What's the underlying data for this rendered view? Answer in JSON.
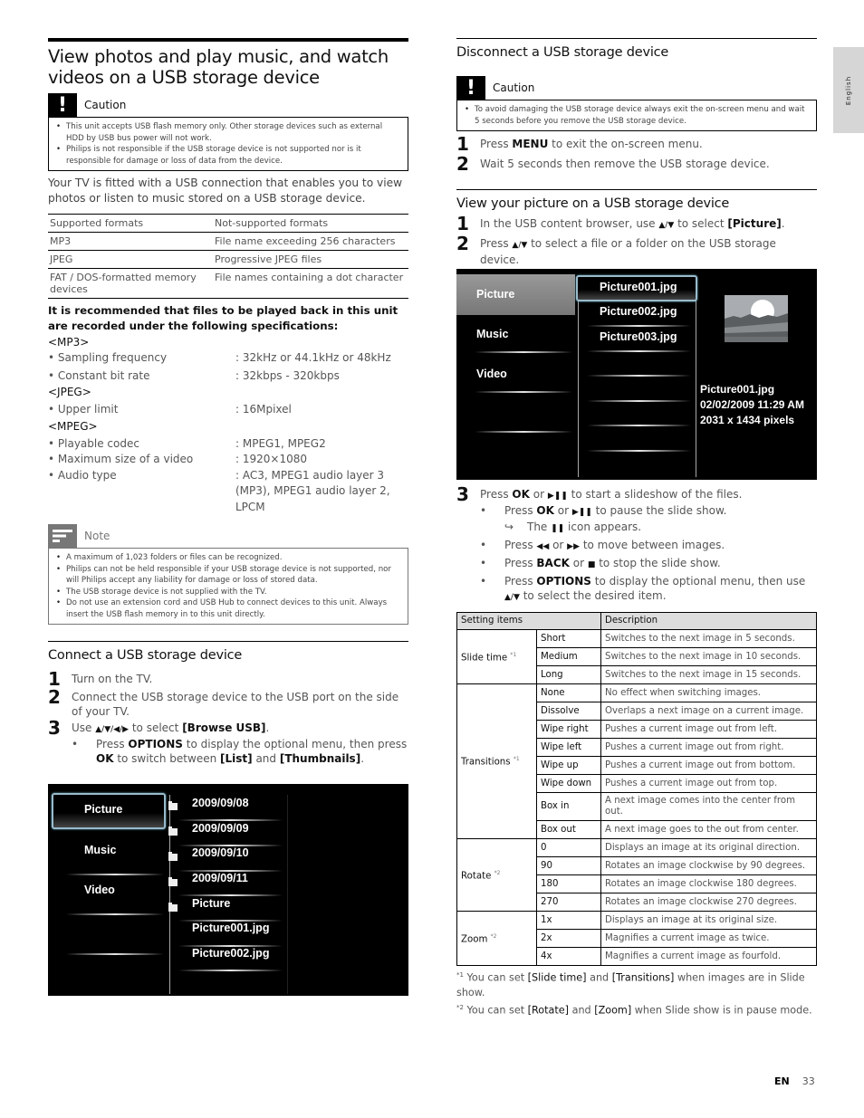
{
  "side_tab": {
    "label": "English"
  },
  "footer": {
    "lang": "EN",
    "page": "33"
  },
  "left": {
    "title": "View photos and play music, and watch videos on a USB storage device",
    "caution": {
      "label": "Caution",
      "icon": "exclamation-icon",
      "items": [
        "This unit accepts USB flash memory only. Other storage devices such as external HDD by USB bus power will not work.",
        "Philips is not responsible if the USB storage device is not supported nor is it responsible for damage or loss of data from the device."
      ]
    },
    "intro": "Your TV is fitted with a USB connection that enables you to view photos or listen to music stored on a USB storage device.",
    "formats_table": {
      "headers": [
        "Supported formats",
        "Not-supported formats"
      ],
      "rows": [
        [
          "MP3",
          "File name exceeding 256 characters"
        ],
        [
          "JPEG",
          "Progressive JPEG files"
        ],
        [
          "FAT / DOS-formatted memory devices",
          "File names containing a dot character"
        ]
      ]
    },
    "recommend": "It is recommended that files to be played back in this unit are recorded under the following specifications:",
    "specs": [
      {
        "group": "<MP3>",
        "items": [
          {
            "key": "• Sampling frequency",
            "value": ": 32kHz or 44.1kHz or 48kHz"
          },
          {
            "key": "• Constant bit rate",
            "value": ": 32kbps - 320kbps"
          }
        ]
      },
      {
        "group": "<JPEG>",
        "items": [
          {
            "key": "• Upper limit",
            "value": ": 16Mpixel"
          }
        ]
      },
      {
        "group": "<MPEG>",
        "items": [
          {
            "key": "• Playable codec",
            "value": ": MPEG1, MPEG2"
          },
          {
            "key": "• Maximum size of a video",
            "value": ": 1920×1080"
          },
          {
            "key": "• Audio type",
            "value": ": AC3, MPEG1 audio layer 3 (MP3), MPEG1 audio layer 2, LPCM"
          }
        ]
      }
    ],
    "note": {
      "label": "Note",
      "icon": "note-lines-icon",
      "items": [
        "A maximum of 1,023 folders or files can be recognized.",
        "Philips can not be held responsible if your USB storage device is not supported, nor will Philips accept any liability for damage or loss of stored data.",
        "The USB storage device is not supplied with the TV.",
        "Do not use an extension cord and USB Hub to connect devices to this unit. Always insert the USB flash memory in to this unit directly."
      ]
    },
    "connect": {
      "heading": "Connect a USB storage device",
      "steps": [
        {
          "num": "1",
          "text": "Turn on the TV."
        },
        {
          "num": "2",
          "text": "Connect the USB storage device to the USB port on the side of your TV."
        },
        {
          "num": "3",
          "pre": "Use ",
          "arrows": "▲/▼/◀/▶",
          "mid": " to select ",
          "bold": "[Browse USB]",
          "post": "."
        }
      ],
      "sub": {
        "a": "Press ",
        "b1": "OPTIONS",
        "c": " to display the optional menu, then press ",
        "b2": "OK",
        "d": " to switch between ",
        "b3": "[List]",
        "e": " and ",
        "b4": "[Thumbnails]",
        "f": "."
      }
    },
    "screen1": {
      "menu": [
        "Picture",
        "Music",
        "Video"
      ],
      "selected_menu": "Picture",
      "files": [
        {
          "name": "2009/09/08",
          "folder": true
        },
        {
          "name": "2009/09/09",
          "folder": true
        },
        {
          "name": "2009/09/10",
          "folder": true
        },
        {
          "name": "2009/09/11",
          "folder": true
        },
        {
          "name": "Picture",
          "folder": true
        },
        {
          "name": "Picture001.jpg",
          "folder": false
        },
        {
          "name": "Picture002.jpg",
          "folder": false
        }
      ]
    }
  },
  "right": {
    "disconnect": {
      "heading": "Disconnect a USB storage device",
      "caution_label": "Caution",
      "caution_items": [
        "To avoid damaging the USB storage device always exit the on-screen menu and wait 5 seconds before you remove the USB storage device."
      ],
      "steps": [
        {
          "num": "1",
          "pre": "Press ",
          "bold": "MENU",
          "post": " to exit the on-screen menu."
        },
        {
          "num": "2",
          "text": "Wait 5 seconds then remove the USB storage device."
        }
      ]
    },
    "view": {
      "heading": "View your picture on a USB storage device",
      "step1": {
        "num": "1",
        "pre": "In the USB content browser, use ",
        "arrows": "▲/▼",
        "mid": " to select ",
        "bold": "[Picture]",
        "post": "."
      },
      "step2": {
        "num": "2",
        "pre": "Press ",
        "arrows": "▲/▼",
        "post": " to select a file or a folder on the USB storage device."
      }
    },
    "screen2": {
      "menu": [
        "Picture",
        "Music",
        "Video"
      ],
      "selected_menu": "Picture",
      "files": [
        "Picture001.jpg",
        "Picture002.jpg",
        "Picture003.jpg"
      ],
      "selected_file": "Picture001.jpg",
      "thumb_icon": "landscape-thumbnail-icon",
      "info": [
        "Picture001.jpg",
        "02/02/2009 11:29 AM",
        "2031 x 1434 pixels"
      ]
    },
    "step3": {
      "num": "3",
      "main": {
        "a": "Press ",
        "b": "OK",
        "c": " or ",
        "sym": "▶❚❚",
        "d": " to start a slideshow of the files."
      },
      "bullets": [
        {
          "a": "Press ",
          "b": "OK",
          "c": " or ",
          "sym": "▶❚❚",
          "d": " to pause the slide show."
        },
        {
          "a": "Press ",
          "sym": "◀◀",
          "c": " or ",
          "sym2": "▶▶",
          "d": " to move between images."
        },
        {
          "a": "Press ",
          "b": "BACK",
          "c": " or ",
          "sym": "■",
          "d": " to stop the slide show."
        },
        {
          "a": "Press ",
          "b": "OPTIONS",
          "c": " to display the optional menu, then use ",
          "sym": "▲/▼",
          "d": " to select the desired item."
        }
      ],
      "result": {
        "arrow": "↪",
        "a": "The ",
        "sym": "❚❚",
        "b": " icon appears."
      }
    },
    "settings_table": {
      "headers": [
        "Setting items",
        "Description"
      ],
      "groups": [
        {
          "name": "Slide time",
          "mark": "*1",
          "rows": [
            [
              "Short",
              "Switches to the next image in 5 seconds."
            ],
            [
              "Medium",
              "Switches to the next image in 10 seconds."
            ],
            [
              "Long",
              "Switches to the next image in 15 seconds."
            ]
          ]
        },
        {
          "name": "Transitions",
          "mark": "*1",
          "rows": [
            [
              "None",
              "No effect when switching images."
            ],
            [
              "Dissolve",
              "Overlaps a next image on a current image."
            ],
            [
              "Wipe right",
              "Pushes a current image out from left."
            ],
            [
              "Wipe left",
              "Pushes a current image out from right."
            ],
            [
              "Wipe up",
              "Pushes a current image out from bottom."
            ],
            [
              "Wipe down",
              "Pushes a current image out from top."
            ],
            [
              "Box in",
              "A next image comes into the center from out."
            ],
            [
              "Box out",
              "A next image goes to the out from center."
            ]
          ]
        },
        {
          "name": "Rotate",
          "mark": "*2",
          "rows": [
            [
              "0",
              "Displays an image at its original direction."
            ],
            [
              "90",
              "Rotates an image clockwise by 90 degrees."
            ],
            [
              "180",
              "Rotates an image clockwise 180 degrees."
            ],
            [
              "270",
              "Rotates an image clockwise 270 degrees."
            ]
          ]
        },
        {
          "name": "Zoom",
          "mark": "*2",
          "rows": [
            [
              "1x",
              "Displays an image at its original size."
            ],
            [
              "2x",
              "Magnifies a current image as twice."
            ],
            [
              "4x",
              "Magnifies a current image as fourfold."
            ]
          ]
        }
      ]
    },
    "footnotes": [
      {
        "mark": "*1",
        "a": " You can set ",
        "b1": "[Slide time]",
        "c": " and ",
        "b2": "[Transitions]",
        "d": " when images are in Slide show."
      },
      {
        "mark": "*2",
        "a": " You can set ",
        "b1": "[Rotate]",
        "c": " and ",
        "b2": "[Zoom]",
        "d": " when Slide show is in pause mode."
      }
    ]
  }
}
